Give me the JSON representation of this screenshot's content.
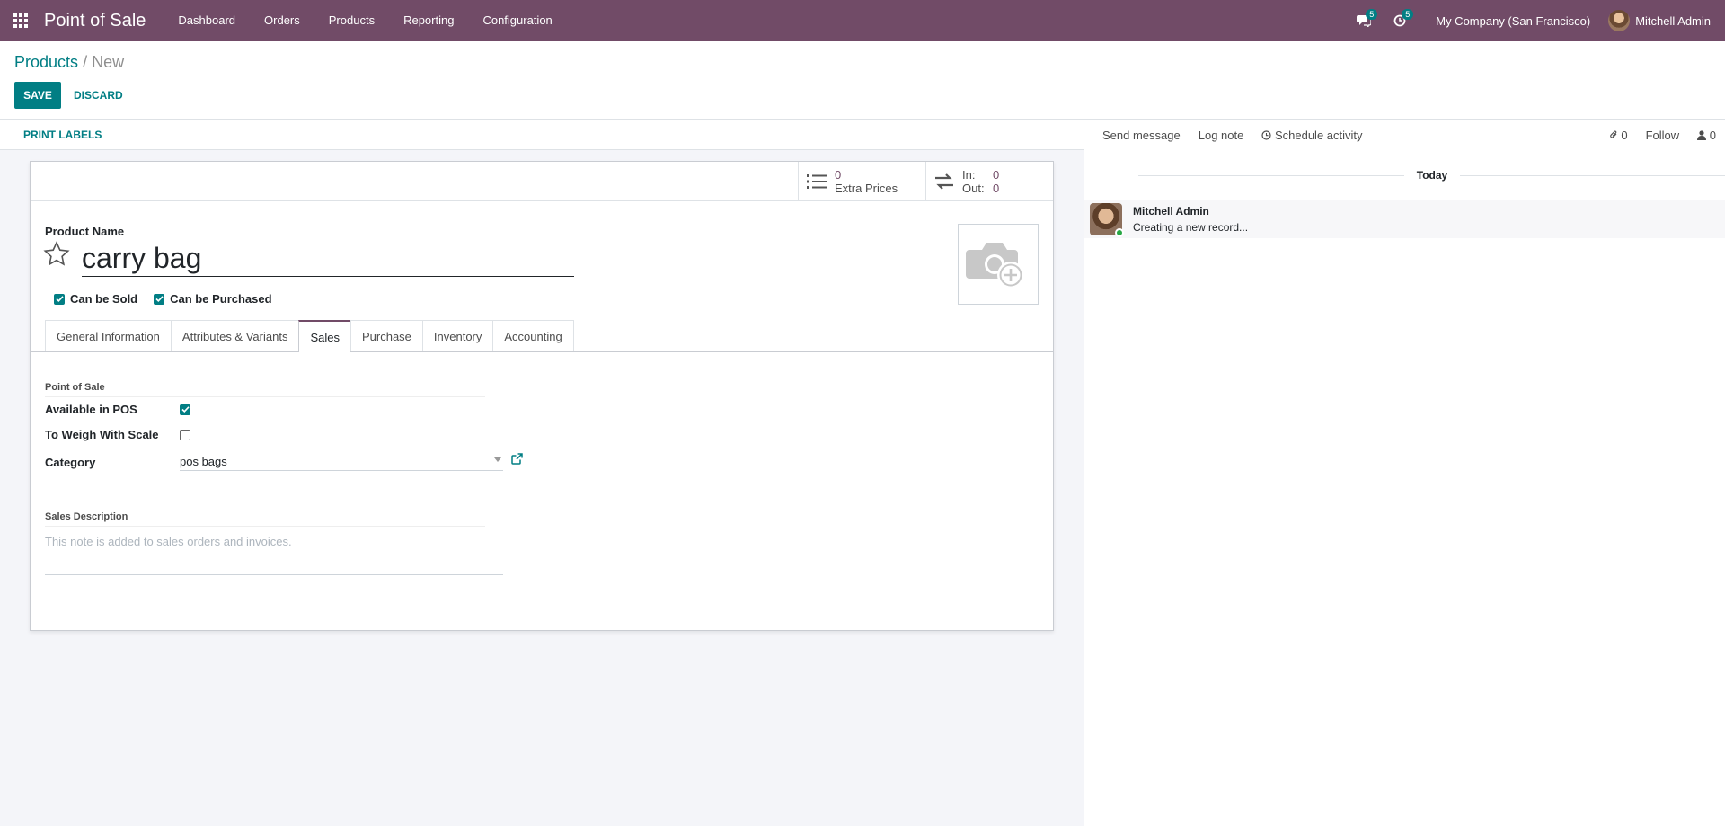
{
  "nav": {
    "app_name": "Point of Sale",
    "menu": [
      "Dashboard",
      "Orders",
      "Products",
      "Reporting",
      "Configuration"
    ],
    "messages_count": "5",
    "activities_count": "5",
    "company": "My Company (San Francisco)",
    "user": "Mitchell Admin"
  },
  "breadcrumb": {
    "parent": "Products",
    "separator": "/",
    "current": "New"
  },
  "buttons": {
    "save": "SAVE",
    "discard": "DISCARD",
    "print_labels": "PRINT LABELS"
  },
  "stat_buttons": {
    "extra_prices_value": "0",
    "extra_prices_label": "Extra Prices",
    "in_label": "In:",
    "in_value": "0",
    "out_label": "Out:",
    "out_value": "0"
  },
  "form": {
    "product_name_label": "Product Name",
    "product_name": "carry bag",
    "can_be_sold_label": "Can be Sold",
    "can_be_purchased_label": "Can be Purchased",
    "tabs": [
      "General Information",
      "Attributes & Variants",
      "Sales",
      "Purchase",
      "Inventory",
      "Accounting"
    ],
    "active_tab": "Sales",
    "pos_group_title": "Point of Sale",
    "available_in_pos_label": "Available in POS",
    "to_weigh_label": "To Weigh With Scale",
    "category_label": "Category",
    "category_value": "pos bags",
    "sales_desc_title": "Sales Description",
    "sales_desc_placeholder": "This note is added to sales orders and invoices."
  },
  "chatter": {
    "send_message": "Send message",
    "log_note": "Log note",
    "schedule_activity": "Schedule activity",
    "attachments_count": "0",
    "follow": "Follow",
    "followers_count": "0",
    "today": "Today",
    "message_author": "Mitchell Admin",
    "message_text": "Creating a new record..."
  },
  "colors": {
    "brand": "#714b67",
    "accent": "#017e84"
  }
}
